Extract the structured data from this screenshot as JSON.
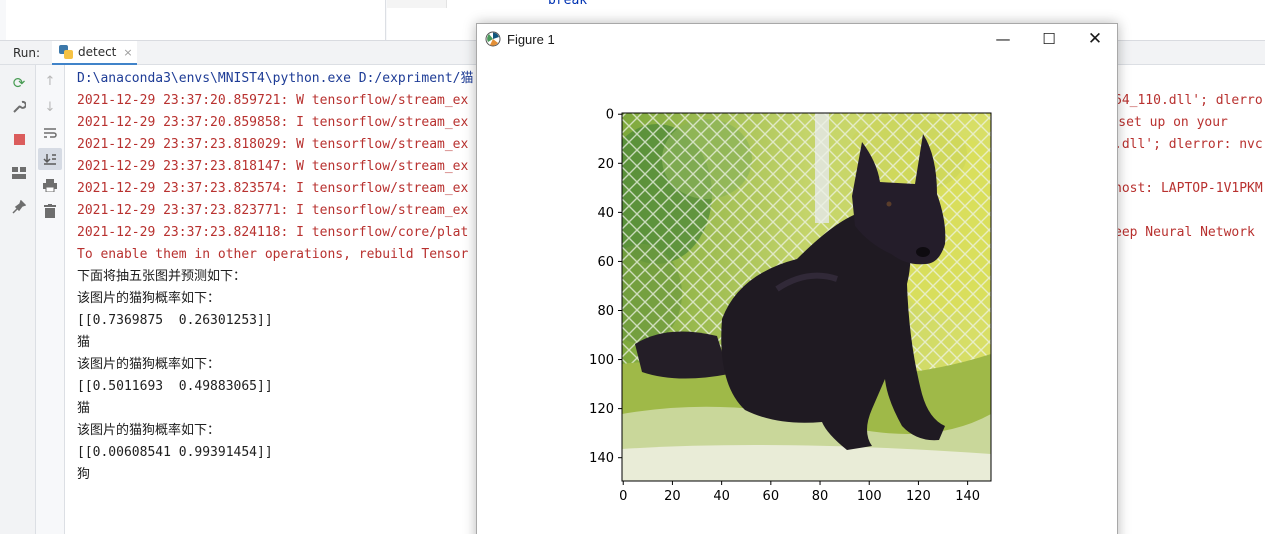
{
  "editor": {
    "code_snippet": "break"
  },
  "run_panel": {
    "label": "Run:",
    "tab_name": "detect",
    "tab_close": "×"
  },
  "toolbar": {
    "rerun_icon": "rerun-icon",
    "wrench_icon": "wrench-icon",
    "stop_icon": "stop-icon",
    "layout_icon": "layout-icon",
    "pin_icon": "pin-icon",
    "up_icon": "arrow-up-icon",
    "down_icon": "arrow-down-icon",
    "softwrap_icon": "soft-wrap-icon",
    "scrollend_icon": "scroll-to-end-icon",
    "print_icon": "print-icon",
    "trash_icon": "trash-icon"
  },
  "console": {
    "lines": [
      "D:\\anaconda3\\envs\\MNIST4\\python.exe D:/expriment/猫",
      "2021-12-29 23:37:20.859721: W tensorflow/stream_ex",
      "2021-12-29 23:37:20.859858: I tensorflow/stream_ex",
      "2021-12-29 23:37:23.818029: W tensorflow/stream_ex",
      "2021-12-29 23:37:23.818147: W tensorflow/stream_ex",
      "2021-12-29 23:37:23.823574: I tensorflow/stream_ex",
      "2021-12-29 23:37:23.823771: I tensorflow/stream_ex",
      "2021-12-29 23:37:23.824118: I tensorflow/core/plat",
      "To enable them in other operations, rebuild Tensor",
      "下面将抽五张图并预测如下：",
      "该图片的猫狗概率如下：",
      "[[0.7369875  0.26301253]]",
      "猫",
      "该图片的猫狗概率如下：",
      "[[0.5011693  0.49883065]]",
      "猫",
      "该图片的猫狗概率如下：",
      "[[0.00608541 0.99391454]]",
      "狗"
    ],
    "right_fragments": [
      "64_110.dll'; dlerro",
      "GPU set up on your",
      ".dll'; dlerror: nvc",
      "host: LAPTOP-1V1PKM",
      "eep Neural Network"
    ]
  },
  "figure": {
    "title": "Figure 1",
    "minimize": "—",
    "maximize": "☐",
    "close": "✕",
    "app_icon": "matplotlib-icon"
  },
  "chart_data": {
    "type": "image",
    "subject": "black dog sitting on grass in front of a chain-link fence",
    "x_ticks": [
      0,
      20,
      40,
      60,
      80,
      100,
      120,
      140
    ],
    "y_ticks": [
      0,
      20,
      40,
      60,
      80,
      100,
      120,
      140
    ],
    "xlim": [
      -0.5,
      149.5
    ],
    "ylim": [
      149.5,
      -0.5
    ],
    "colors": {
      "foliage": "#b7c84a",
      "grass": "#8fae3a",
      "dog": "#1f1a22",
      "fence": "#e8eee0"
    }
  }
}
